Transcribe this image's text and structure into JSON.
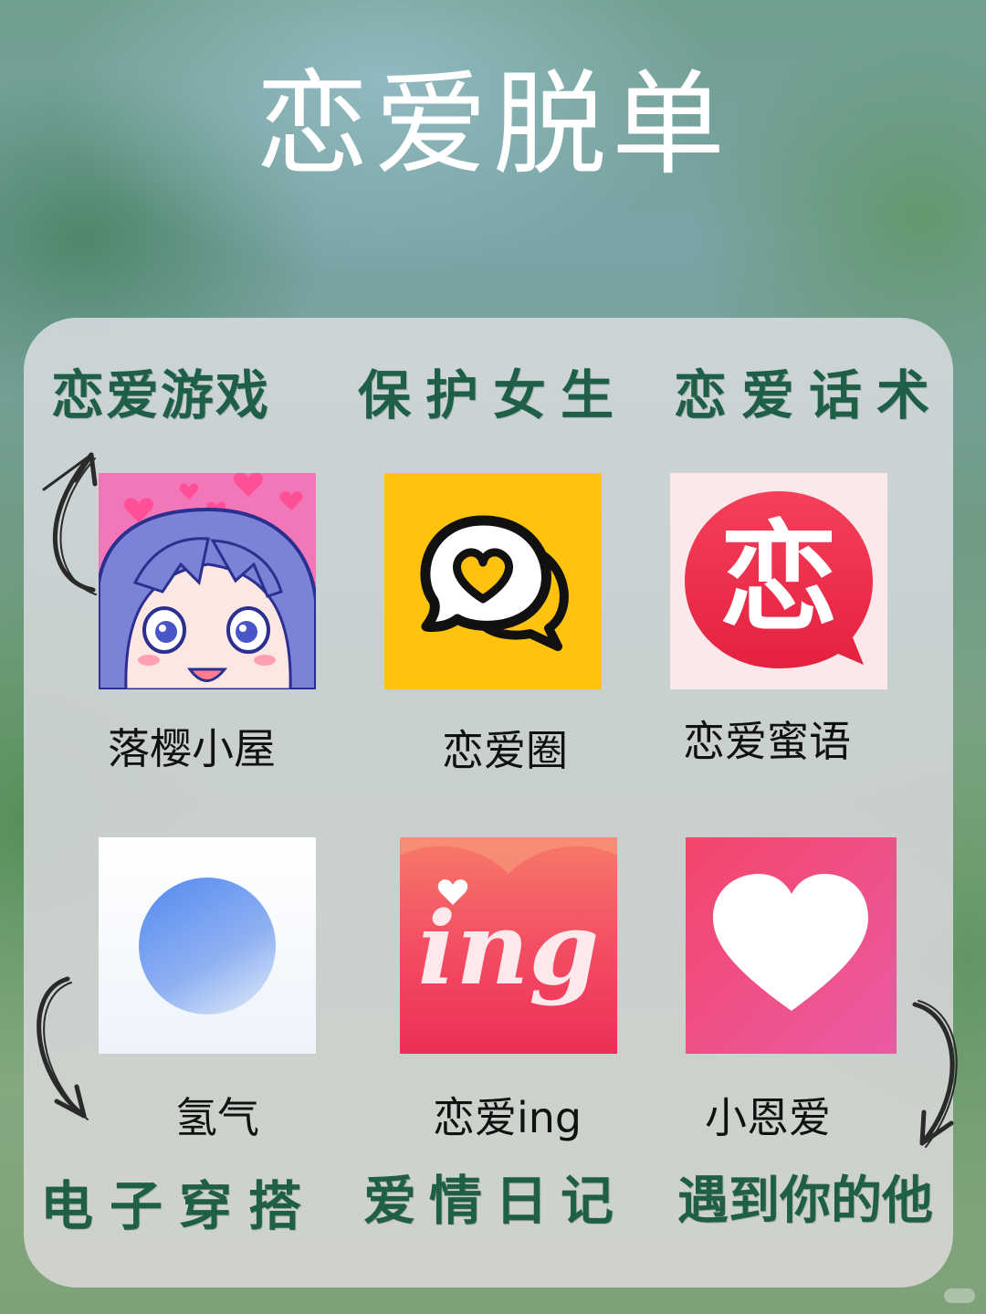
{
  "title": "恋爱脱单",
  "categories": {
    "top_left": "恋爱游戏",
    "top_middle": "保护女生",
    "top_right": "恋爱话术",
    "bottom_left": "电子穿搭",
    "bottom_middle": "爱情日记",
    "bottom_right": "遇到你的他"
  },
  "apps": [
    {
      "label": "落樱小屋",
      "icon": "anime-girl-icon"
    },
    {
      "label": "恋爱圈",
      "icon": "heart-speech-bubble-icon"
    },
    {
      "label": "恋爱蜜语",
      "icon": "lian-speech-bubble-icon",
      "glyph": "恋"
    },
    {
      "label": "氢气",
      "icon": "blue-circle-icon"
    },
    {
      "label": "恋爱ing",
      "icon": "ing-heart-icon",
      "glyph": "ing"
    },
    {
      "label": "小恩爱",
      "icon": "white-heart-icon"
    }
  ],
  "colors": {
    "category_text": "#1f5e47",
    "icon_yellow": "#ffc20e",
    "icon_red": "#ee2a4f",
    "icon_pink": "#f0507a"
  }
}
